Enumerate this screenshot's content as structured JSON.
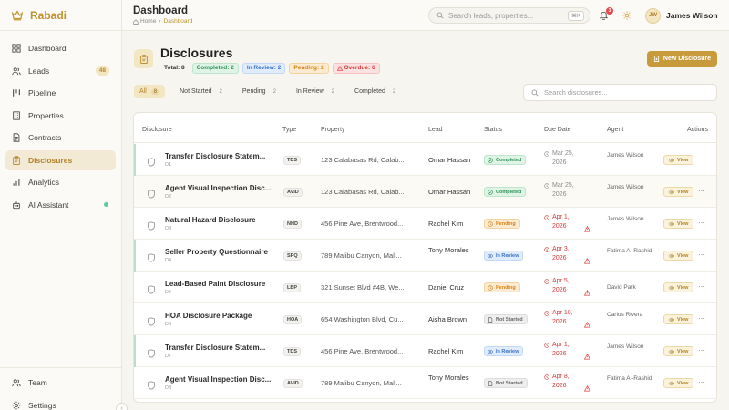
{
  "brand": {
    "name": "Rabadi"
  },
  "nav": {
    "items": [
      {
        "label": "Dashboard"
      },
      {
        "label": "Leads",
        "badge": "48"
      },
      {
        "label": "Pipeline"
      },
      {
        "label": "Properties"
      },
      {
        "label": "Contracts"
      },
      {
        "label": "Disclosures"
      },
      {
        "label": "Analytics"
      },
      {
        "label": "AI Assistant"
      }
    ],
    "bottom": [
      {
        "label": "Team"
      },
      {
        "label": "Settings"
      }
    ],
    "collapse_glyph": "‹"
  },
  "topbar": {
    "title": "Dashboard",
    "breadcrumb": [
      "Home",
      "Dashboard"
    ],
    "search_placeholder": "Search leads, properties...",
    "search_shortcut": "⌘K",
    "notification_count": "3",
    "user": {
      "initials": "JW",
      "name": "James Wilson"
    }
  },
  "header": {
    "title": "Disclosures",
    "stats": {
      "total": "Total: 8",
      "completed": "Completed: 2",
      "in_review": "In Review: 2",
      "pending": "Pending: 2",
      "overdue": "Overdue: 6"
    },
    "new_button": "New Disclosure"
  },
  "tabs": [
    {
      "label": "All",
      "count": "8"
    },
    {
      "label": "Not Started",
      "count": "2"
    },
    {
      "label": "Pending",
      "count": "2"
    },
    {
      "label": "In Review",
      "count": "2"
    },
    {
      "label": "Completed",
      "count": "2"
    }
  ],
  "filter_search_placeholder": "Search disclosures...",
  "table": {
    "headers": [
      "Disclosure",
      "Type",
      "Property",
      "Lead",
      "Status",
      "Due Date",
      "Agent",
      "Actions"
    ],
    "view_label": "View",
    "more_label": "···",
    "rows": [
      {
        "title": "Transfer Disclosure Statem...",
        "id": "D1",
        "type": "TDS",
        "property": "123 Calabasas Rd, Calab...",
        "lead": "Omar Hassan",
        "status": "Completed",
        "due": "Mar 25, 2026",
        "overdue": false,
        "agent": "James Wilson"
      },
      {
        "title": "Agent Visual Inspection Disc...",
        "id": "D2",
        "type": "AVID",
        "property": "123 Calabasas Rd, Calab...",
        "lead": "Omar Hassan",
        "status": "Completed",
        "due": "Mar 25, 2026",
        "overdue": false,
        "agent": "James Wilson"
      },
      {
        "title": "Natural Hazard Disclosure",
        "id": "D3",
        "type": "NHD",
        "property": "456 Pine Ave, Brentwood...",
        "lead": "Rachel Kim",
        "status": "Pending",
        "due": "Apr 1, 2026",
        "overdue": true,
        "agent": "James Wilson"
      },
      {
        "title": "Seller Property Questionnaire",
        "id": "D4",
        "type": "SPQ",
        "property": "789 Malibu Canyon, Mali...",
        "lead": "Tony Morales",
        "status": "In Review",
        "due": "Apr 3, 2026",
        "overdue": true,
        "agent": "Fatima Al-Rashid"
      },
      {
        "title": "Lead-Based Paint Disclosure",
        "id": "D5",
        "type": "LBP",
        "property": "321 Sunset Blvd #4B, We...",
        "lead": "Daniel Cruz",
        "status": "Pending",
        "due": "Apr 5, 2026",
        "overdue": true,
        "agent": "David Park"
      },
      {
        "title": "HOA Disclosure Package",
        "id": "D6",
        "type": "HOA",
        "property": "654 Washington Blvd, Cu...",
        "lead": "Aisha Brown",
        "status": "Not Started",
        "due": "Apr 10, 2026",
        "overdue": true,
        "agent": "Carlos Rivera"
      },
      {
        "title": "Transfer Disclosure Statem...",
        "id": "D7",
        "type": "TDS",
        "property": "456 Pine Ave, Brentwood...",
        "lead": "Rachel Kim",
        "status": "In Review",
        "due": "Apr 1, 2026",
        "overdue": true,
        "agent": "James Wilson"
      },
      {
        "title": "Agent Visual Inspection Disc...",
        "id": "D8",
        "type": "AVID",
        "property": "789 Malibu Canyon, Mali...",
        "lead": "Tony Morales",
        "status": "Not Started",
        "due": "Apr 8, 2026",
        "overdue": true,
        "agent": "Fatima Al-Rashid"
      }
    ]
  },
  "colors": {
    "accent": "#c79a3c",
    "completed": "#2e9556",
    "in_review": "#3a73c9",
    "pending": "#d48418",
    "overdue": "#d93a3a"
  },
  "icons": {
    "brand": "crown-icon",
    "search": "search-icon",
    "bell": "bell-icon",
    "theme": "sun-icon",
    "disclosure": "shield-icon",
    "due": "clock-icon",
    "overdue": "alert-icon",
    "view": "eye-icon"
  }
}
